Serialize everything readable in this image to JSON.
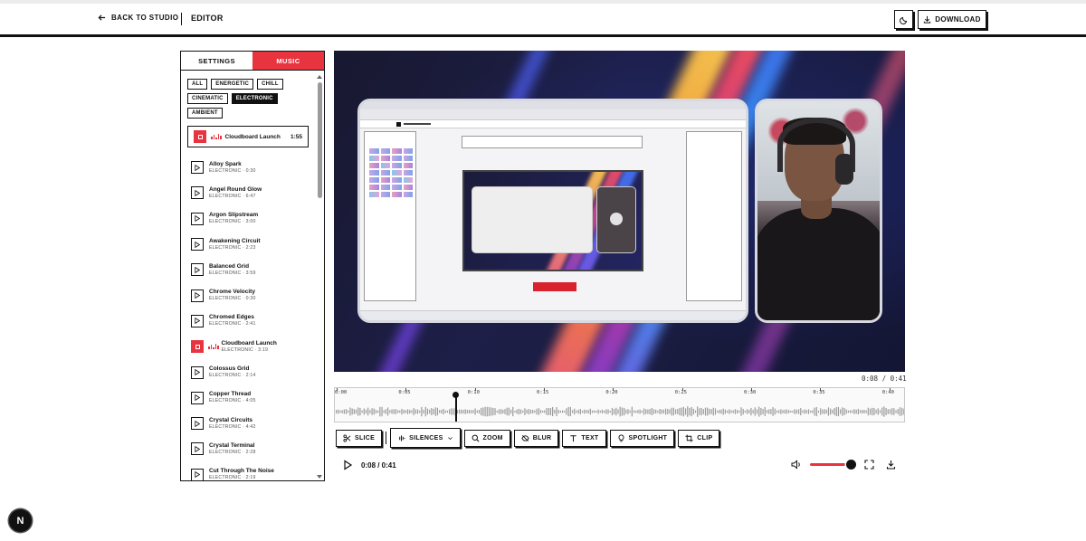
{
  "header": {
    "back_label": "BACK TO STUDIO",
    "title": "EDITOR",
    "download_label": "DOWNLOAD"
  },
  "sidebar": {
    "tabs": [
      {
        "label": "SETTINGS",
        "active": false
      },
      {
        "label": "MUSIC",
        "active": true
      }
    ],
    "filters": [
      {
        "label": "ALL",
        "active": false
      },
      {
        "label": "ENERGETIC",
        "active": false
      },
      {
        "label": "CHILL",
        "active": false
      },
      {
        "label": "CINEMATIC",
        "active": false
      },
      {
        "label": "ELECTRONIC",
        "active": true
      },
      {
        "label": "AMBIENT",
        "active": false
      }
    ],
    "current_track": {
      "name": "Cloudboard Launch",
      "duration": "1:55"
    },
    "tracks": [
      {
        "name": "Alloy Spark",
        "sub": "ELECTRONIC · 0:30",
        "playing": false
      },
      {
        "name": "Angel Round Glow",
        "sub": "ELECTRONIC · 6:47",
        "playing": false
      },
      {
        "name": "Argon Slipstream",
        "sub": "ELECTRONIC · 3:00",
        "playing": false
      },
      {
        "name": "Awakening Circuit",
        "sub": "ELECTRONIC · 2:23",
        "playing": false
      },
      {
        "name": "Balanced Grid",
        "sub": "ELECTRONIC · 3:59",
        "playing": false
      },
      {
        "name": "Chrome Velocity",
        "sub": "ELECTRONIC · 0:30",
        "playing": false
      },
      {
        "name": "Chromed Edges",
        "sub": "ELECTRONIC · 2:41",
        "playing": false
      },
      {
        "name": "Cloudboard Launch",
        "sub": "ELECTRONIC · 3:19",
        "playing": true
      },
      {
        "name": "Colossus Grid",
        "sub": "ELECTRONIC · 2:14",
        "playing": false
      },
      {
        "name": "Copper Thread",
        "sub": "ELECTRONIC · 4:05",
        "playing": false
      },
      {
        "name": "Crystal Circuits",
        "sub": "ELECTRONIC · 4:42",
        "playing": false
      },
      {
        "name": "Crystal Terminal",
        "sub": "ELECTRONIC · 2:28",
        "playing": false
      },
      {
        "name": "Cut Through The Noise",
        "sub": "ELECTRONIC · 2:19",
        "playing": false
      }
    ]
  },
  "player": {
    "time_overlay": "0:08 / 0:41",
    "time_display": "0:08 / 0:41",
    "current_seconds": 8,
    "total_seconds": 41,
    "volume": 0.9
  },
  "timeline": {
    "ticks": [
      "0:00",
      "0:05",
      "0:10",
      "0:15",
      "0:20",
      "0:25",
      "0:30",
      "0:35",
      "0:40"
    ]
  },
  "tools": [
    {
      "label": "SLICE",
      "icon": "scissors-icon"
    },
    {
      "label": "SILENCES",
      "icon": "waveform-icon"
    },
    {
      "label": "ZOOM",
      "icon": "zoom-icon"
    },
    {
      "label": "BLUR",
      "icon": "eye-off-icon"
    },
    {
      "label": "TEXT",
      "icon": "text-icon"
    },
    {
      "label": "SPOTLIGHT",
      "icon": "lightbulb-icon"
    },
    {
      "label": "CLIP",
      "icon": "crop-icon"
    }
  ],
  "badge": {
    "letter": "N"
  },
  "colors": {
    "accent": "#e8343f",
    "ink": "#111111"
  }
}
